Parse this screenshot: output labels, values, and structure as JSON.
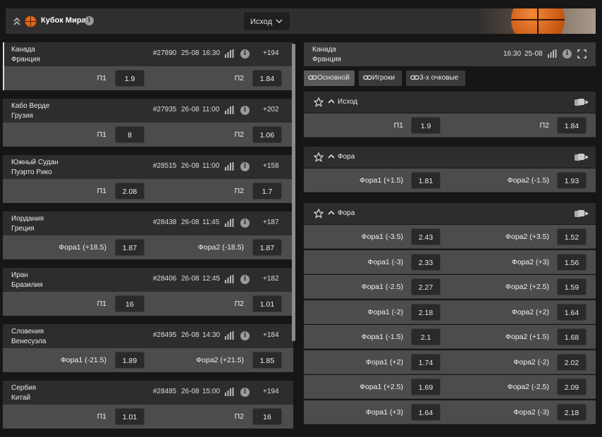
{
  "header": {
    "title": "Кубок Мира",
    "dropdown": "Исход",
    "info": "i"
  },
  "matches": [
    {
      "team1": "Канада",
      "team2": "Франция",
      "id": "#27890",
      "date": "25-08",
      "time": "16:30",
      "count": "+194",
      "l1": "П1",
      "o1": "1.9",
      "l2": "П2",
      "o2": "1.84"
    },
    {
      "team1": "Кабо Верде",
      "team2": "Грузия",
      "id": "#27935",
      "date": "26-08",
      "time": "11:00",
      "count": "+202",
      "l1": "П1",
      "o1": "8",
      "l2": "П2",
      "o2": "1.06"
    },
    {
      "team1": "Южный Судан",
      "team2": "Пуэрто Рико",
      "id": "#28515",
      "date": "26-08",
      "time": "11:00",
      "count": "+158",
      "l1": "П1",
      "o1": "2.08",
      "l2": "П2",
      "o2": "1.7"
    },
    {
      "team1": "Иордания",
      "team2": "Греция",
      "id": "#28438",
      "date": "26-08",
      "time": "11:45",
      "count": "+187",
      "l1": "Фора1 (+18.5)",
      "o1": "1.87",
      "l2": "Фора2 (-18.5)",
      "o2": "1.87"
    },
    {
      "team1": "Иран",
      "team2": "Бразилия",
      "id": "#28406",
      "date": "26-08",
      "time": "12:45",
      "count": "+182",
      "l1": "П1",
      "o1": "16",
      "l2": "П2",
      "o2": "1.01"
    },
    {
      "team1": "Словения",
      "team2": "Венесуэла",
      "id": "#28495",
      "date": "26-08",
      "time": "14:30",
      "count": "+184",
      "l1": "Фора1 (-21.5)",
      "o1": "1.89",
      "l2": "Фора2 (+21.5)",
      "o2": "1.85"
    },
    {
      "team1": "Сербия",
      "team2": "Китай",
      "id": "#28485",
      "date": "26-08",
      "time": "15:00",
      "count": "+194",
      "l1": "П1",
      "o1": "1.01",
      "l2": "П2",
      "o2": "16"
    }
  ],
  "detail": {
    "team1": "Канада",
    "team2": "Франция",
    "time": "16:30",
    "date": "25-08",
    "tabs": [
      "Основной",
      "Игроки",
      "3-х очковые"
    ],
    "sections": [
      {
        "name": "Исход",
        "rows": [
          {
            "l1": "П1",
            "o1": "1.9",
            "l2": "П2",
            "o2": "1.84"
          }
        ]
      },
      {
        "name": "Фора",
        "rows": [
          {
            "l1": "Фора1 (+1.5)",
            "o1": "1.81",
            "l2": "Фора2 (-1.5)",
            "o2": "1.93"
          }
        ]
      },
      {
        "name": "Фора",
        "rows": [
          {
            "l1": "Фора1 (-3.5)",
            "o1": "2.43",
            "l2": "Фора2 (+3.5)",
            "o2": "1.52"
          },
          {
            "l1": "Фора1 (-3)",
            "o1": "2.33",
            "l2": "Фора2 (+3)",
            "o2": "1.56"
          },
          {
            "l1": "Фора1 (-2.5)",
            "o1": "2.27",
            "l2": "Фора2 (+2.5)",
            "o2": "1.59"
          },
          {
            "l1": "Фора1 (-2)",
            "o1": "2.18",
            "l2": "Фора2 (+2)",
            "o2": "1.64"
          },
          {
            "l1": "Фора1 (-1.5)",
            "o1": "2.1",
            "l2": "Фора2 (+1.5)",
            "o2": "1.68"
          },
          {
            "l1": "Фора1 (+2)",
            "o1": "1.74",
            "l2": "Фора2 (-2)",
            "o2": "2.02"
          },
          {
            "l1": "Фора1 (+2.5)",
            "o1": "1.69",
            "l2": "Фора2 (-2.5)",
            "o2": "2.09"
          },
          {
            "l1": "Фора1 (+3)",
            "o1": "1.64",
            "l2": "Фора2 (-3)",
            "o2": "2.18"
          }
        ]
      }
    ]
  },
  "colors": {
    "accent": "#e06a1d",
    "panel": "#2d2d2d",
    "row": "#4c4c4c",
    "odd": "#2a2a2a"
  }
}
